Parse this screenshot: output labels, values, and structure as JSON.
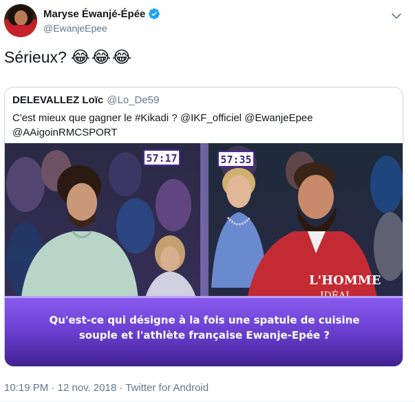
{
  "author": {
    "name": "Maryse Éwanjé-Épée",
    "handle": "@EwanjeEpee",
    "verified": true
  },
  "tweet": {
    "text": "Sérieux?",
    "emojis": [
      "😂",
      "😂",
      "😂"
    ]
  },
  "quoted_tweet": {
    "name": "DELEVALLEZ Loïc",
    "handle": "@Lo_De59",
    "text_line1": "C'est mieux que gagner le #Kikadi ? @IKF_officiel @EwanjeEpee",
    "text_line2": "@AAigoinRMCSPORT",
    "media": {
      "timer_left": "57:17",
      "timer_right": "57:35",
      "shirt_text_line1": "L'HOMME",
      "shirt_text_line2": "IDÉAL",
      "caption_line1": "Qu'est-ce qui désigne à la fois une spatule de cuisine",
      "caption_line2": "souple et l'athlète française Ewanje-Epée ?"
    }
  },
  "meta": {
    "timestamp": "10:19 PM · 12 nov. 2018 · Twitter for Android"
  },
  "colors": {
    "text_primary": "#14171a",
    "text_secondary": "#657786",
    "verified_blue": "#1da1f2",
    "border": "#ccd6dd",
    "tv_purple": "#6a3fd0"
  },
  "icons": {
    "verified": "verified-badge-icon",
    "menu": "chevron-down-icon"
  }
}
